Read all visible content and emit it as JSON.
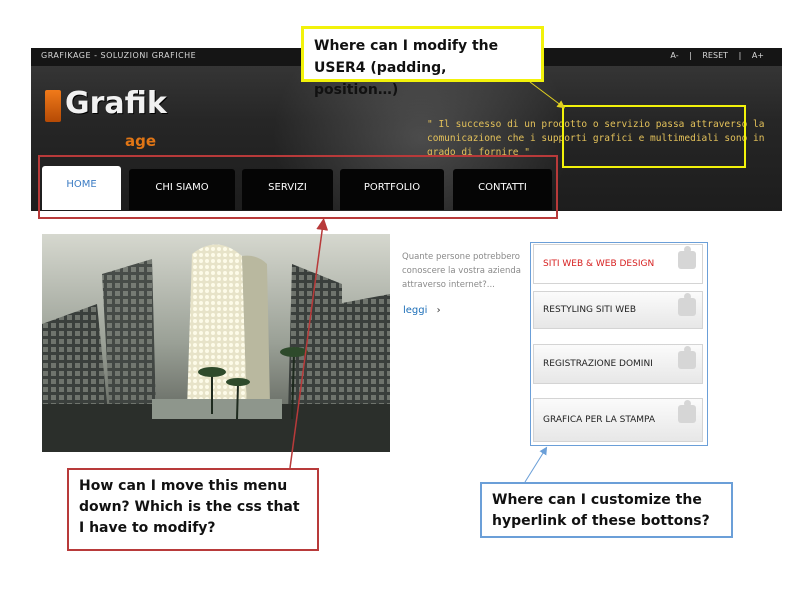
{
  "header": {
    "site_tag": "GRAFIKAGE - SOLUZIONI GRAFICHE",
    "font_tools": [
      "A-",
      "|",
      "RESET",
      "|",
      "A+"
    ],
    "logo_text": "Grafik",
    "logo_sub": "age",
    "quote": "\" Il successo di un prodotto o servizio passa attraverso la comunicazione che i supporti grafici e multimediali sono in grado di fornire \""
  },
  "nav": {
    "items": [
      {
        "label": "HOME",
        "active": true
      },
      {
        "label": "CHI SIAMO",
        "active": false
      },
      {
        "label": "SERVIZI",
        "active": false
      },
      {
        "label": "PORTFOLIO",
        "active": false
      },
      {
        "label": "CONTATTI",
        "active": false
      }
    ]
  },
  "content": {
    "intro_text": "Quante persone potrebbero conoscere la vostra azienda attraverso internet?...",
    "read_more": "leggi",
    "read_more_arrow": "›"
  },
  "sidebar": {
    "buttons": [
      {
        "label": "SITI WEB & WEB DESIGN",
        "active": true
      },
      {
        "label": "RESTYLING SITI WEB",
        "active": false
      },
      {
        "label": "REGISTRAZIONE DOMINI",
        "active": false
      },
      {
        "label": "GRAFICA PER LA STAMPA",
        "active": false
      }
    ]
  },
  "annotations": {
    "user4_question": "Where can I modify the USER4 (padding, position…)",
    "menu_question": "How can I move this menu down? Which is the css that I have to modify?",
    "links_question": "Where can I customize the hyperlink of these bottons?"
  },
  "colors": {
    "accent_orange": "#e07515",
    "quote_gold": "#e3c15a",
    "nav_active_text": "#3c7cc4",
    "sidebar_active_text": "#d72020",
    "annotation_yellow": "#f2f20a",
    "annotation_red": "#b83a3a",
    "annotation_blue": "#6b9fd8"
  },
  "icons": [
    "puzzle-icon",
    "arrow-right-icon"
  ]
}
